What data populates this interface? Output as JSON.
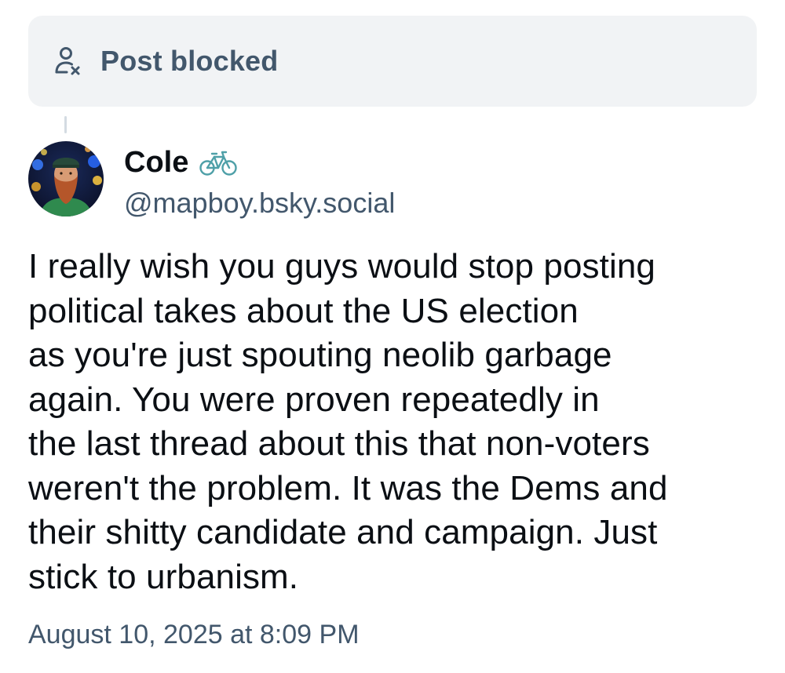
{
  "banner": {
    "label": "Post blocked",
    "icon": "person-x-icon"
  },
  "author": {
    "display_name": "Cole",
    "name_emoji": "bicycle-icon",
    "handle": "@mapboy.bsky.social",
    "avatar": "avatar"
  },
  "post": {
    "text": "I really wish you guys would stop posting\npolitical takes about the US election\nas you're just spouting neolib garbage\nagain. You were proven repeatedly in\nthe last thread about this that non-voters\nweren't the problem. It was the Dems and\ntheir shitty candidate and campaign. Just\nstick to urbanism.",
    "timestamp": "August 10, 2025 at 8:09 PM"
  },
  "colors": {
    "banner_bg": "#f1f3f5",
    "muted_text": "#42576c",
    "primary_text": "#0b0f14",
    "thread_line": "#d4dbe2"
  }
}
